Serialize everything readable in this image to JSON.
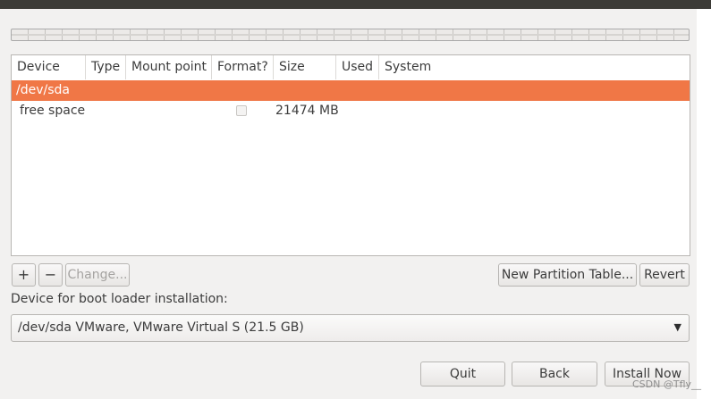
{
  "table": {
    "columns": [
      "Device",
      "Type",
      "Mount point",
      "Format?",
      "Size",
      "Used",
      "System"
    ],
    "rows": [
      {
        "device": "/dev/sda",
        "selected": true
      },
      {
        "device": "free space",
        "format_checked": false,
        "size": "21474 MB"
      }
    ]
  },
  "toolbar": {
    "add_label": "+",
    "remove_label": "−",
    "change_label": "Change...",
    "new_table_label": "New Partition Table...",
    "revert_label": "Revert"
  },
  "bootloader": {
    "label": "Device for boot loader installation:",
    "selected": "/dev/sda VMware, VMware Virtual S (21.5 GB)"
  },
  "actions": {
    "quit_label": "Quit",
    "back_label": "Back",
    "install_label": "Install Now"
  },
  "watermark": "CSDN @Tfly__",
  "colors": {
    "accent": "#f07746",
    "background": "#f2f1f0",
    "titlebar": "#3c3b37"
  }
}
